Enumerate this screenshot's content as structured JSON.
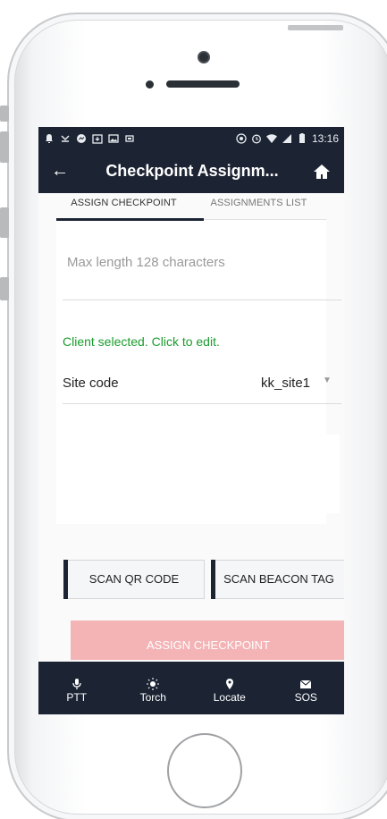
{
  "status_bar": {
    "time": "13:16"
  },
  "toolbar": {
    "title": "Checkpoint Assignm..."
  },
  "tabs": [
    {
      "label": "ASSIGN CHECKPOINT",
      "active": true
    },
    {
      "label": "ASSIGNMENTS LIST",
      "active": false
    }
  ],
  "form": {
    "input_placeholder": "Max length 128 characters",
    "client_status": "Client selected. Click to edit.",
    "site_code_label": "Site code",
    "site_code_value": "kk_site1"
  },
  "buttons": {
    "scan_qr": "SCAN QR CODE",
    "scan_beacon": "SCAN BEACON TAG",
    "assign": "ASSIGN CHECKPOINT"
  },
  "bottom_nav": [
    {
      "label": "PTT",
      "icon": "microphone-icon"
    },
    {
      "label": "Torch",
      "icon": "sun-icon"
    },
    {
      "label": "Locate",
      "icon": "location-pin-icon"
    },
    {
      "label": "SOS",
      "icon": "envelope-icon"
    }
  ],
  "colors": {
    "primary_dark": "#1c2434",
    "success_text": "#1a9c2c",
    "assign_disabled": "#f4b3b5"
  }
}
